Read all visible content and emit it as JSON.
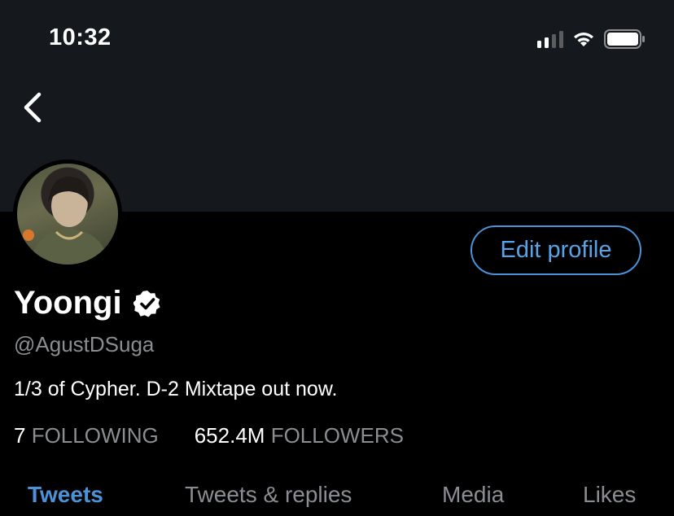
{
  "status_bar": {
    "time": "10:32"
  },
  "profile": {
    "name": "Yoongi",
    "handle": "@AgustDSuga",
    "bio": "1/3 of Cypher. D-2 Mixtape out now.",
    "edit_button_label": "Edit profile",
    "following_count": "7",
    "following_label": "FOLLOWING",
    "followers_count": "652.4M",
    "followers_label": "FOLLOWERS"
  },
  "tabs": [
    {
      "label": "Tweets",
      "active": true
    },
    {
      "label": "Tweets & replies",
      "active": false
    },
    {
      "label": "Media",
      "active": false
    },
    {
      "label": "Likes",
      "active": false
    }
  ],
  "colors": {
    "accent": "#4b92d6",
    "banner": "#15181c",
    "muted": "#8a8d91"
  }
}
